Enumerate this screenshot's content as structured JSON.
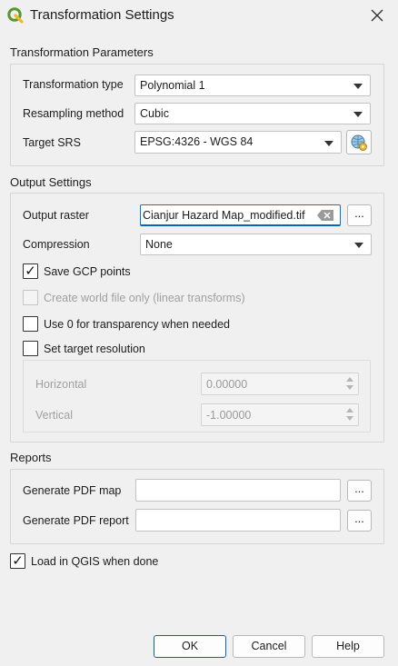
{
  "window": {
    "title": "Transformation Settings",
    "app_icon": "qgis-logo-icon",
    "close_icon": "close-icon"
  },
  "transformation_parameters": {
    "section_title": "Transformation Parameters",
    "type_label": "Transformation type",
    "type_value": "Polynomial 1",
    "resampling_label": "Resampling method",
    "resampling_value": "Cubic",
    "srs_label": "Target SRS",
    "srs_value": "EPSG:4326 - WGS 84",
    "srs_button_icon": "projection-globe-icon"
  },
  "output_settings": {
    "section_title": "Output Settings",
    "raster_label": "Output raster",
    "raster_value": "Cianjur Hazard Map_modified.tif",
    "browse_label": "...",
    "compression_label": "Compression",
    "compression_value": "None",
    "save_gcp_label": "Save GCP points",
    "save_gcp_checked": true,
    "world_file_label": "Create world file only (linear transforms)",
    "world_file_checked": false,
    "transparency_label": "Use 0 for transparency when needed",
    "transparency_checked": false,
    "target_res_label": "Set target resolution",
    "target_res_checked": false,
    "horizontal_label": "Horizontal",
    "horizontal_value": "0.00000",
    "vertical_label": "Vertical",
    "vertical_value": "-1.00000"
  },
  "reports": {
    "section_title": "Reports",
    "pdf_map_label": "Generate PDF map",
    "pdf_map_value": "",
    "pdf_report_label": "Generate PDF report",
    "pdf_report_value": "",
    "browse_label": "..."
  },
  "load_in_qgis": {
    "label": "Load in QGIS when done",
    "checked": true
  },
  "buttons": {
    "ok": "OK",
    "cancel": "Cancel",
    "help": "Help"
  },
  "colors": {
    "accent": "#0078d7",
    "qgis_green": "#589632",
    "qgis_yellow": "#eeb927"
  }
}
